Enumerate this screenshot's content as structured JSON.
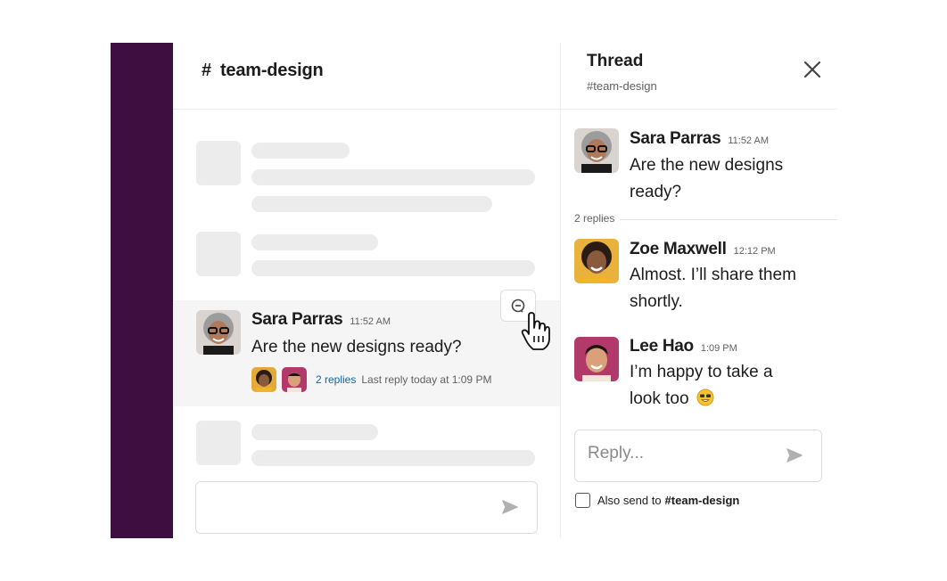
{
  "channel": {
    "hash": "#",
    "name": "team-design",
    "featured_message": {
      "author": "Sara Parras",
      "time": "11:52 AM",
      "text": "Are the new designs ready?",
      "replies_link": "2 replies",
      "last_reply": "Last reply today at 1:09 PM"
    }
  },
  "thread": {
    "title": "Thread",
    "subtitle": "#team-design",
    "divider_label": "2 replies",
    "messages": [
      {
        "author": "Sara Parras",
        "time": "11:52 AM",
        "text": "Are the new designs ready?"
      },
      {
        "author": "Zoe Maxwell",
        "time": "12:12 PM",
        "text": "Almost. I’ll share them shortly."
      },
      {
        "author": "Lee Hao",
        "time": "1:09 PM",
        "text": "I’m happy to take a look too"
      }
    ],
    "reply_placeholder": "Reply...",
    "also_send_label": "Also send to",
    "also_send_channel": "#team-design"
  },
  "icons": {
    "send": "send-icon",
    "close": "close-icon",
    "reply_action": "reply-in-thread-icon",
    "cursor": "hand-pointer-icon",
    "emoji": "grinning-face-icon"
  },
  "colors": {
    "sidebar": "#3f0e40",
    "link": "#1264a3",
    "skeleton": "#ececec",
    "highlight_row": "#f5f5f5"
  }
}
